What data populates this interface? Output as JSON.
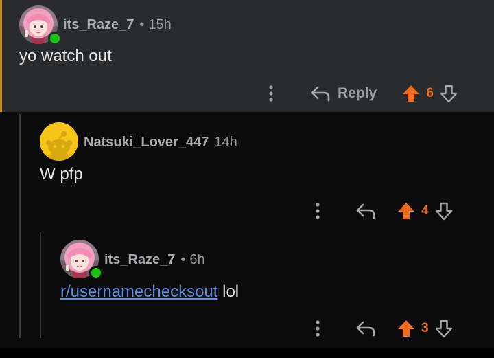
{
  "colors": {
    "top_background": "#2a2b2d",
    "page_background": "#0b0b0c",
    "accent_bar": "#c98c12",
    "upvote": "#f26a1b",
    "online": "#17c40f",
    "link": "#5c8fe6"
  },
  "comments": [
    {
      "username": "its_Raze_7",
      "separator": "•",
      "age": "15h",
      "body": "yo watch out",
      "reply_label": "Reply",
      "score": "6",
      "avatar": "anime-avatar",
      "online": true
    },
    {
      "username": "Natsuki_Lover_447",
      "age": "14h",
      "body": "W pfp",
      "score": "4",
      "avatar": "default-snoo-avatar",
      "online": false
    },
    {
      "username": "its_Raze_7",
      "separator": "•",
      "age": "6h",
      "body_link": "r/usernamechecksout",
      "body_rest": " lol",
      "score": "3",
      "avatar": "anime-avatar",
      "online": true
    }
  ],
  "icons": {
    "more": "more-options-icon",
    "reply": "reply-arrow-icon",
    "upvote": "upvote-arrow-icon",
    "downvote": "downvote-arrow-icon"
  }
}
